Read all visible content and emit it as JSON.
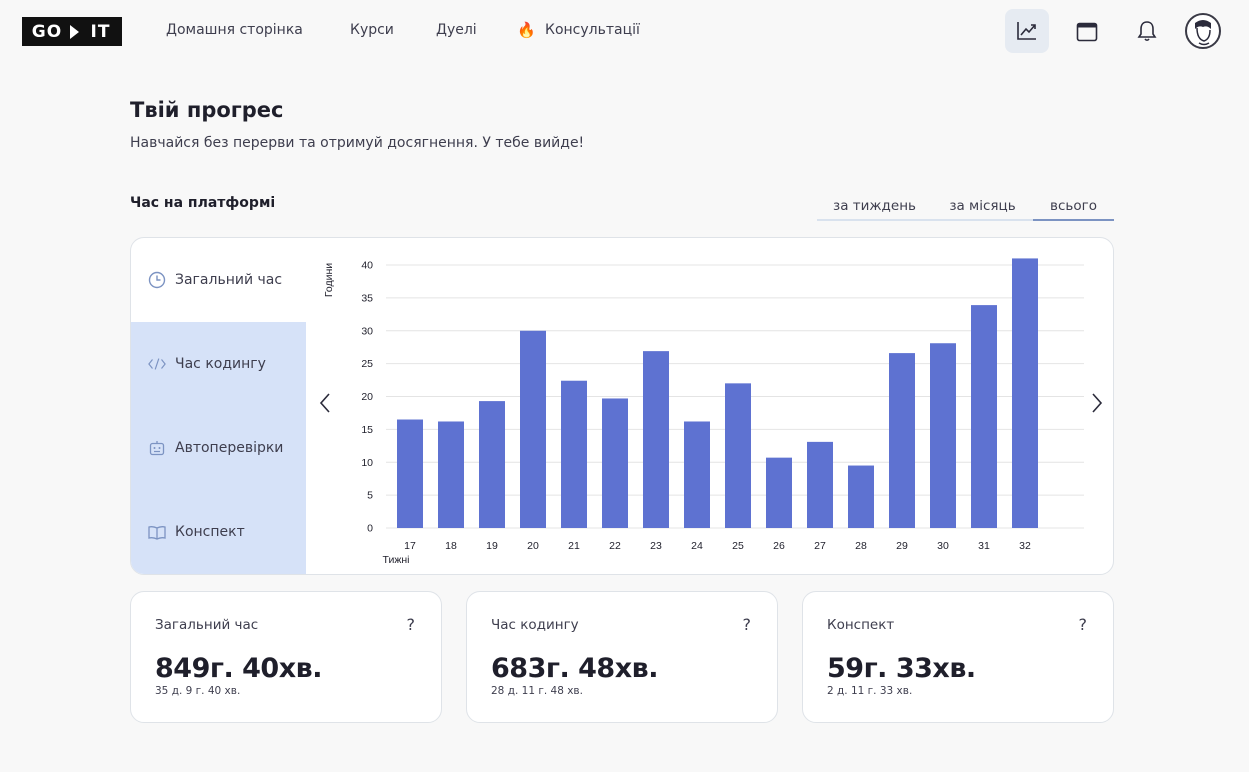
{
  "logo": {
    "left": "GO",
    "right": "IT"
  },
  "nav": [
    {
      "label": "Домашня сторінка"
    },
    {
      "label": "Курси"
    },
    {
      "label": "Дуелі"
    },
    {
      "label": "Консультації",
      "icon": "fire-icon"
    }
  ],
  "header_icons": [
    "progress-chart-icon",
    "calendar-icon",
    "bell-icon",
    "user-avatar"
  ],
  "page": {
    "title": "Твій прогрес",
    "subtitle": "Навчайся без перерви та отримуй досягнення. У тебе вийде!",
    "section_title": "Час на платформі"
  },
  "tabs": [
    {
      "label": "за тиждень",
      "active": false
    },
    {
      "label": "за місяць",
      "active": false
    },
    {
      "label": "всього",
      "active": true
    }
  ],
  "sidebar": [
    {
      "label": "Загальний час",
      "icon": "clock-icon",
      "selected": false
    },
    {
      "label": "Час кодингу",
      "icon": "code-icon",
      "selected": true
    },
    {
      "label": "Автоперевірки",
      "icon": "robot-icon",
      "selected": true
    },
    {
      "label": "Конспект",
      "icon": "book-icon",
      "selected": true
    }
  ],
  "chart_data": {
    "type": "bar",
    "xlabel": "Тижні",
    "ylabel": "Години",
    "categories": [
      "17",
      "18",
      "19",
      "20",
      "21",
      "22",
      "23",
      "24",
      "25",
      "26",
      "27",
      "28",
      "29",
      "30",
      "31",
      "32"
    ],
    "values": [
      16.5,
      16.2,
      19.3,
      30,
      22.4,
      19.7,
      26.9,
      16.2,
      22,
      10.7,
      13.1,
      9.5,
      26.6,
      28.1,
      33.9,
      41
    ],
    "ylim": [
      0,
      40
    ],
    "yticks": [
      "0",
      "5",
      "10",
      "15",
      "20",
      "25",
      "30",
      "35",
      "40"
    ],
    "grid": true,
    "bar_color": "#5e72d1"
  },
  "stats": [
    {
      "label": "Загальний час",
      "help": "?",
      "big": "849г. 40хв.",
      "small": "35 д. 9 г. 40 хв."
    },
    {
      "label": "Час кодингу",
      "help": "?",
      "big": "683г. 48хв.",
      "small": "28 д. 11 г. 48 хв."
    },
    {
      "label": "Конспект",
      "help": "?",
      "big": "59г. 33хв.",
      "small": "2 д. 11 г. 33 хв."
    }
  ]
}
